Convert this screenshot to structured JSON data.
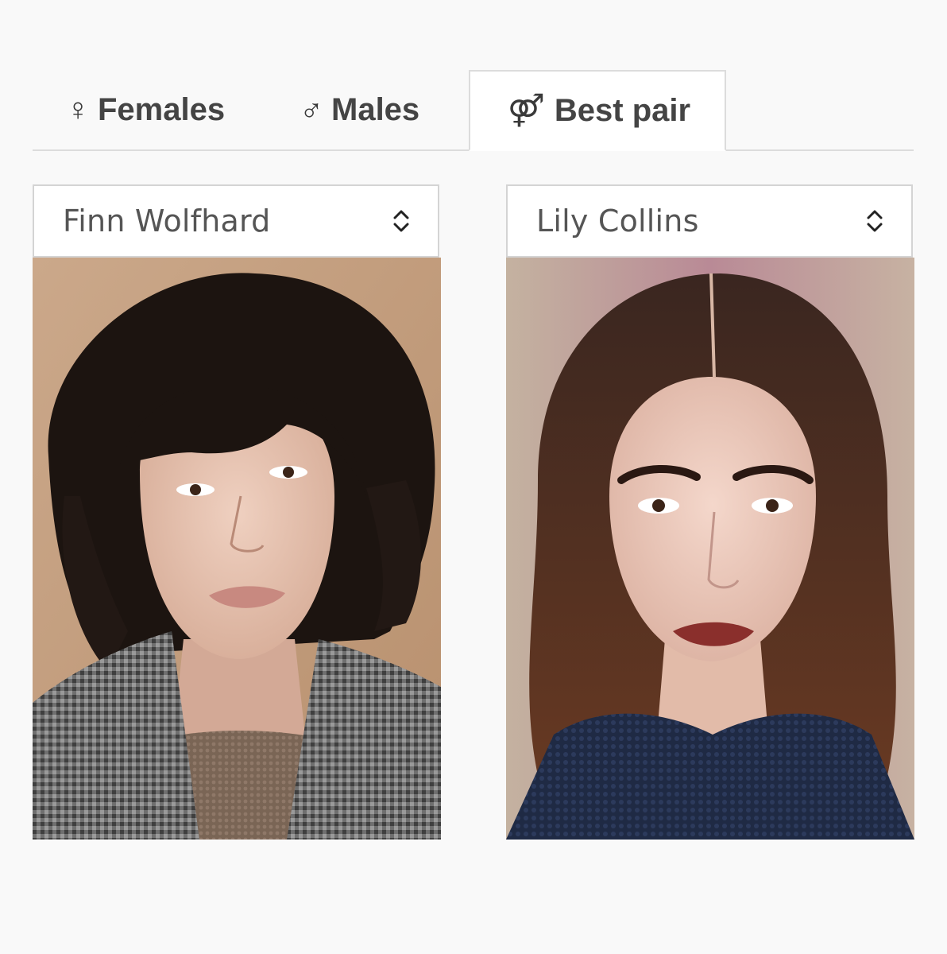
{
  "tabs": {
    "females": {
      "glyph": "♀",
      "label": "Females",
      "icon": "female-symbol-icon"
    },
    "males": {
      "glyph": "♂",
      "label": "Males",
      "icon": "male-symbol-icon"
    },
    "best_pair": {
      "glyph": "⚤",
      "label": "Best pair",
      "icon": "pair-symbol-icon",
      "active": true
    }
  },
  "left_select": {
    "value": "Finn Wolfhard",
    "icon": "chevron-up-down-icon"
  },
  "right_select": {
    "value": "Lily Collins",
    "icon": "chevron-up-down-icon"
  },
  "colors": {
    "background": "#f9f9f9",
    "tab_text": "#444444",
    "border": "#dcdcdc",
    "select_text": "#555555"
  }
}
